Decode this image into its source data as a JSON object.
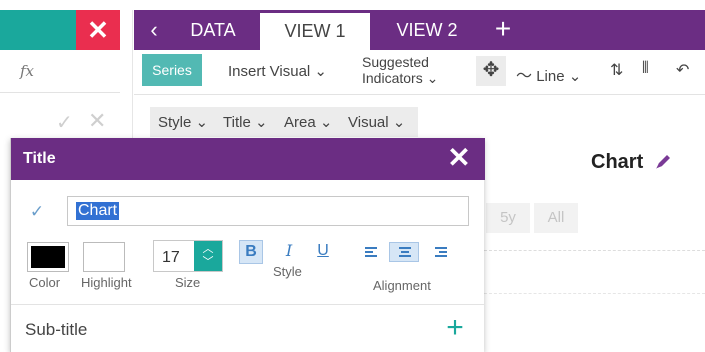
{
  "formula": {
    "fx_label": "fx"
  },
  "tabs": [
    "DATA",
    "VIEW 1",
    "VIEW 2"
  ],
  "active_tab": "VIEW 1",
  "toolbar": {
    "series_label": "Series",
    "insert_visual_label": "Insert Visual ⌄",
    "suggested_line1": "Suggested",
    "suggested_line2": "Indicators ⌄",
    "line_label": "Line ⌄"
  },
  "subtoolbar": {
    "style_label": "Style ⌄",
    "title_label": "Title ⌄",
    "area_label": "Area ⌄",
    "visual_label": "Visual ⌄"
  },
  "chart": {
    "title": "Chart",
    "range_buttons": [
      "5y",
      "All"
    ]
  },
  "dialog": {
    "header": "Title",
    "title_value": "Chart",
    "color_label": "Color",
    "highlight_label": "Highlight",
    "size_value": "17",
    "size_label": "Size",
    "style_label": "Style",
    "alignment_label": "Alignment",
    "style_buttons": {
      "bold": "B",
      "italic": "I",
      "underline": "U"
    },
    "subtitle_label": "Sub-title",
    "color_value": "#000000"
  },
  "colors": {
    "purple": "#6b2d83",
    "teal": "#1aa89c",
    "red": "#ea2e4f",
    "series_teal": "#52b9b3"
  }
}
